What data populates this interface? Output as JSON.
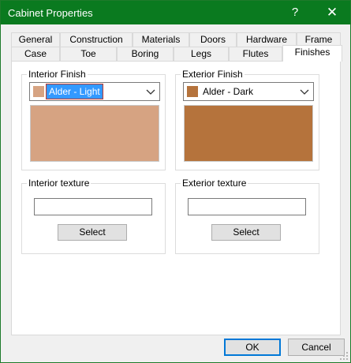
{
  "window": {
    "title": "Cabinet Properties",
    "help_glyph": "?",
    "close_glyph": "✕"
  },
  "tabs_row1": [
    "General",
    "Construction",
    "Materials",
    "Doors",
    "Hardware",
    "Frame"
  ],
  "tabs_row2": [
    "Case",
    "Toe",
    "Boring",
    "Legs",
    "Flutes",
    "Finishes"
  ],
  "active_tab": "Finishes",
  "interior_finish": {
    "label": "Interior Finish",
    "selected": "Alder - Light",
    "color": "#d6a382"
  },
  "exterior_finish": {
    "label": "Exterior Finish",
    "selected": "Alder - Dark",
    "color": "#b5733c"
  },
  "interior_texture": {
    "label": "Interior texture",
    "value": "",
    "button": "Select"
  },
  "exterior_texture": {
    "label": "Exterior texture",
    "value": "",
    "button": "Select"
  },
  "buttons": {
    "ok": "OK",
    "cancel": "Cancel"
  }
}
